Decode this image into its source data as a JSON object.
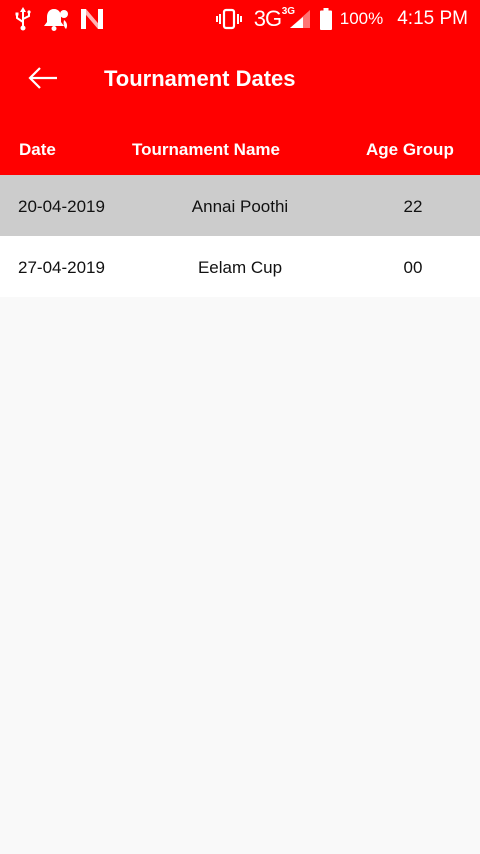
{
  "status_bar": {
    "left_icons": [
      "usb-icon",
      "bell-icon",
      "n-logo-icon"
    ],
    "network_type": "3G",
    "network_sup": "3G",
    "battery_percent": "100%",
    "time": "4:15 PM"
  },
  "app_bar": {
    "back_icon": "arrow-left-icon",
    "title": "Tournament Dates"
  },
  "table": {
    "headers": {
      "date": "Date",
      "name": "Tournament Name",
      "age_group": "Age Group"
    },
    "rows": [
      {
        "date": "20-04-2019",
        "name": "Annai Poothi",
        "age_group": "22"
      },
      {
        "date": "27-04-2019",
        "name": "Eelam Cup",
        "age_group": "00"
      }
    ]
  },
  "colors": {
    "primary": "#ff0000",
    "row_highlight": "#cccccc",
    "row_default": "#ffffff",
    "background": "#f9f9f9",
    "text_on_primary": "#ffffff",
    "text": "#111111"
  }
}
